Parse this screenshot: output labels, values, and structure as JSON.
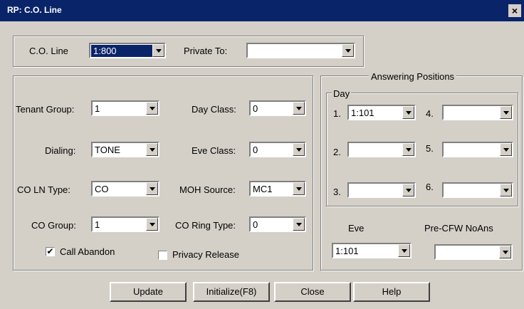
{
  "window": {
    "title": "RP: C.O. Line",
    "close_label": "×"
  },
  "co_line": {
    "label": "C.O. Line",
    "value": "1:800",
    "private_to_label": "Private To:",
    "private_to_value": ""
  },
  "settings": {
    "tenant_group": {
      "label": "Tenant Group:",
      "value": "1"
    },
    "dialing": {
      "label": "Dialing:",
      "value": "TONE"
    },
    "co_ln_type": {
      "label": "CO LN Type:",
      "value": "CO"
    },
    "co_group": {
      "label": "CO Group:",
      "value": "1"
    },
    "day_class": {
      "label": "Day Class:",
      "value": "0"
    },
    "eve_class": {
      "label": "Eve Class:",
      "value": "0"
    },
    "moh_source": {
      "label": "MOH Source:",
      "value": "MC1"
    },
    "co_ring_type": {
      "label": "CO Ring Type:",
      "value": "0"
    },
    "call_abandon": {
      "label": "Call Abandon",
      "checked": true,
      "mark": "✔"
    },
    "privacy_release": {
      "label": "Privacy Release",
      "checked": false,
      "mark": ""
    }
  },
  "answering": {
    "title": "Answering Positions",
    "day_title": "Day",
    "positions": [
      {
        "num": "1.",
        "value": "1:101"
      },
      {
        "num": "2.",
        "value": ""
      },
      {
        "num": "3.",
        "value": ""
      },
      {
        "num": "4.",
        "value": ""
      },
      {
        "num": "5.",
        "value": ""
      },
      {
        "num": "6.",
        "value": ""
      }
    ],
    "eve_label": "Eve",
    "eve_value": "1:101",
    "pre_cfw_label": "Pre-CFW NoAns",
    "pre_cfw_value": ""
  },
  "buttons": {
    "update": "Update",
    "initialize": "Initialize(F8)",
    "close": "Close",
    "help": "Help"
  }
}
